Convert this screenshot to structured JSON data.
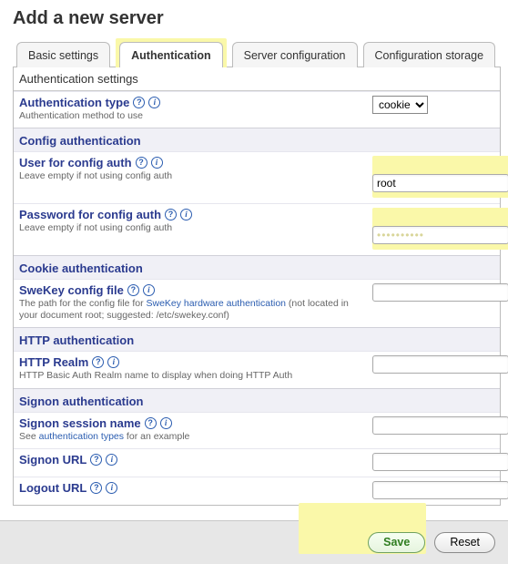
{
  "page_title": "Add a new server",
  "tabs": {
    "basic": "Basic settings",
    "auth": "Authentication",
    "server_cfg": "Server configuration",
    "cfg_storage": "Configuration storage",
    "active": "auth"
  },
  "panel_title": "Authentication settings",
  "auth_type": {
    "label": "Authentication type",
    "hint": "Authentication method to use",
    "value": "cookie",
    "options": [
      "cookie"
    ]
  },
  "sections": {
    "config_auth": "Config authentication",
    "cookie_auth": "Cookie authentication",
    "http_auth": "HTTP authentication",
    "signon_auth": "Signon authentication"
  },
  "config_user": {
    "label": "User for config auth",
    "hint": "Leave empty if not using config auth",
    "value": "root"
  },
  "config_pass": {
    "label": "Password for config auth",
    "hint": "Leave empty if not using config auth",
    "value": "••••••••••"
  },
  "swekey": {
    "label": "SweKey config file",
    "hint_pre": "The path for the config file for ",
    "hint_link": "SweKey hardware authentication",
    "hint_post": " (not located in your document root; suggested: /etc/swekey.conf)",
    "value": ""
  },
  "http_realm": {
    "label": "HTTP Realm",
    "hint": "HTTP Basic Auth Realm name to display when doing HTTP Auth",
    "value": ""
  },
  "signon_session": {
    "label": "Signon session name",
    "hint_pre": "See ",
    "hint_link": "authentication types",
    "hint_post": " for an example",
    "value": ""
  },
  "signon_url": {
    "label": "Signon URL",
    "value": ""
  },
  "logout_url": {
    "label": "Logout URL",
    "value": ""
  },
  "buttons": {
    "save": "Save",
    "reset": "Reset"
  }
}
